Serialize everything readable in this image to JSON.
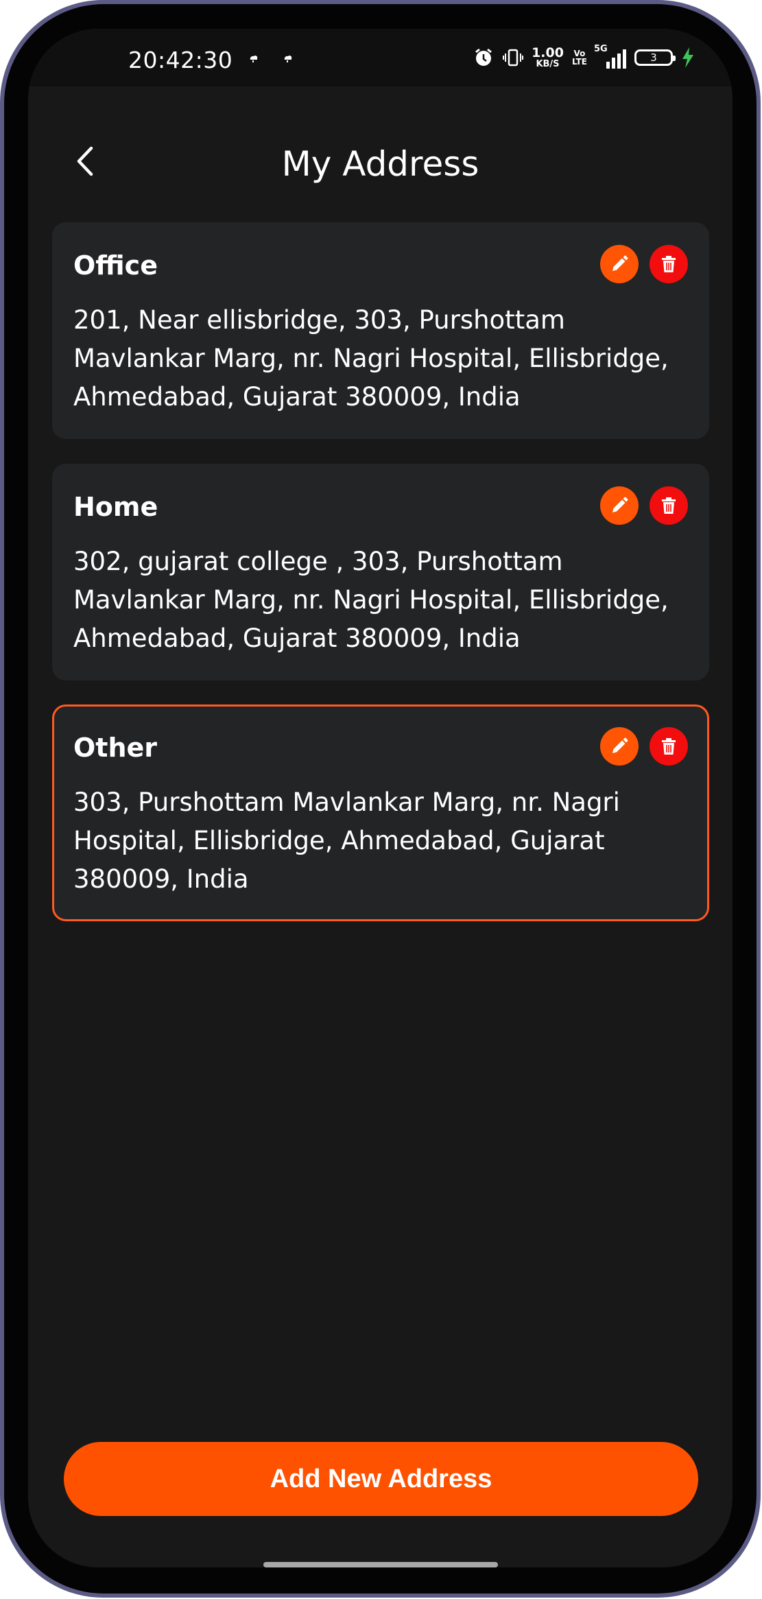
{
  "status_bar": {
    "time": "20:42:30",
    "net_speed_value": "1.00",
    "net_speed_unit": "KB/S",
    "volte_top": "Vo",
    "volte_bottom": "LTE",
    "network": "5G",
    "battery_level": "3",
    "charging_color": "#3fc45a"
  },
  "header": {
    "title": "My Address",
    "back_icon": "chevron-left-icon"
  },
  "addresses": [
    {
      "label": "Office",
      "address": "201, Near ellisbridge, 303, Purshottam Mavlankar Marg, nr. Nagri Hospital, Ellisbridge, Ahmedabad, Gujarat 380009, India",
      "selected": false
    },
    {
      "label": "Home",
      "address": "302, gujarat college , 303, Purshottam Mavlankar Marg, nr. Nagri Hospital, Ellisbridge, Ahmedabad, Gujarat 380009, India",
      "selected": false
    },
    {
      "label": "Other",
      "address": "303, Purshottam Mavlankar Marg, nr. Nagri Hospital, Ellisbridge, Ahmedabad, Gujarat 380009, India",
      "selected": true
    }
  ],
  "actions": {
    "edit_icon": "pencil-icon",
    "delete_icon": "trash-icon",
    "add_label": "Add New Address"
  },
  "colors": {
    "accent": "#ff5200",
    "edit_button": "#ff5505",
    "delete_button": "#f20e0e",
    "background": "#181818",
    "card": "#232425"
  }
}
